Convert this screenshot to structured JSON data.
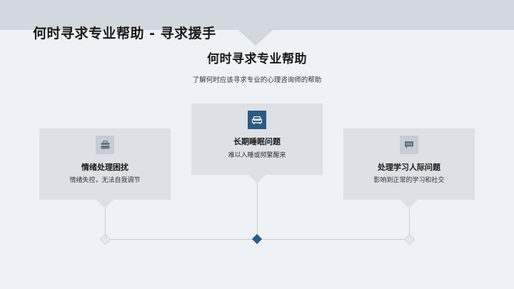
{
  "header": {
    "title": "何时寻求专业帮助 - 寻求援手"
  },
  "main": {
    "title": "何时寻求专业帮助",
    "subtitle": "了解何时应该寻求专业的心理咨询师的帮助"
  },
  "cards": [
    {
      "title": "情绪处理困扰",
      "description": "情绪失控，无法自我调节",
      "icon": "briefcase-icon"
    },
    {
      "title": "长期睡眠问题",
      "description": "难以入睡或频繁醒来",
      "icon": "sofa-icon"
    },
    {
      "title": "处理学习人际问题",
      "description": "影响到正常的学习和社交",
      "icon": "chat-bubble-icon"
    }
  ],
  "colors": {
    "background": "#eef1f5",
    "band": "#d3d8de",
    "card": "#dde1e6",
    "accent": "#2e5a84"
  }
}
